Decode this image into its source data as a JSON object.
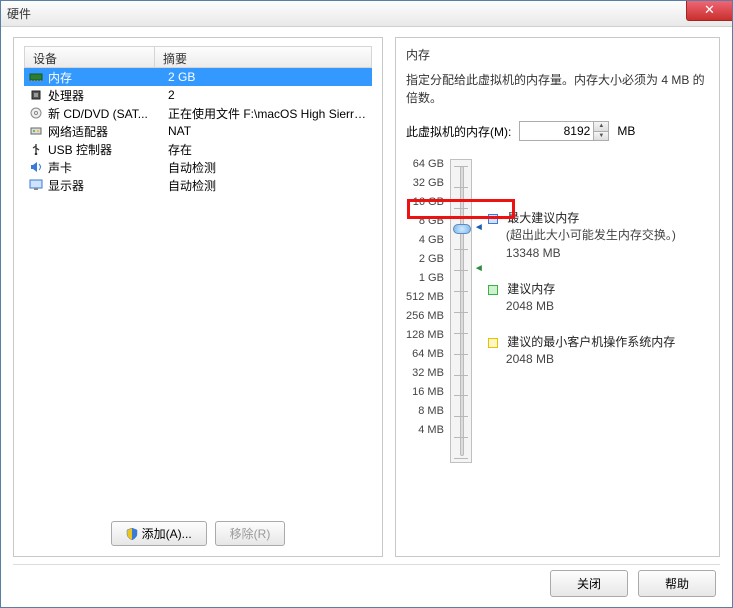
{
  "window": {
    "title": "硬件"
  },
  "leftPanel": {
    "headers": {
      "device": "设备",
      "summary": "摘要"
    },
    "rows": [
      {
        "icon": "memory-icon",
        "name": "内存",
        "summary": "2 GB",
        "selected": true
      },
      {
        "icon": "cpu-icon",
        "name": "处理器",
        "summary": "2"
      },
      {
        "icon": "cd-icon",
        "name": "新 CD/DVD (SAT...",
        "summary": "正在使用文件 F:\\macOS High Sierra ..."
      },
      {
        "icon": "network-icon",
        "name": "网络适配器",
        "summary": "NAT"
      },
      {
        "icon": "usb-icon",
        "name": "USB 控制器",
        "summary": "存在"
      },
      {
        "icon": "sound-icon",
        "name": "声卡",
        "summary": "自动检测"
      },
      {
        "icon": "display-icon",
        "name": "显示器",
        "summary": "自动检测"
      }
    ],
    "buttons": {
      "add": "添加(A)...",
      "remove": "移除(R)"
    }
  },
  "rightPanel": {
    "title": "内存",
    "desc": "指定分配给此虚拟机的内存量。内存大小必须为 4 MB 的倍数。",
    "memLabel": "此虚拟机的内存(M):",
    "memValue": "8192",
    "memUnit": "MB",
    "ticks": [
      "64 GB",
      "32 GB",
      "16 GB",
      "8 GB",
      "4 GB",
      "2 GB",
      "1 GB",
      "512 MB",
      "256 MB",
      "128 MB",
      "64 MB",
      "32 MB",
      "16 MB",
      "8 MB",
      "4 MB"
    ],
    "thumbIndex": 3,
    "legend": {
      "maxTitle": "最大建议内存",
      "maxNote": "(超出此大小可能发生内存交换。)",
      "maxValue": "13348 MB",
      "recTitle": "建议内存",
      "recValue": "2048 MB",
      "minTitle": "建议的最小客户机操作系统内存",
      "minValue": "2048 MB"
    },
    "colors": {
      "blue": "#3a7bd5",
      "green": "#3cb043",
      "yellow": "#e6c200"
    }
  },
  "footer": {
    "close": "关闭",
    "help": "帮助"
  }
}
